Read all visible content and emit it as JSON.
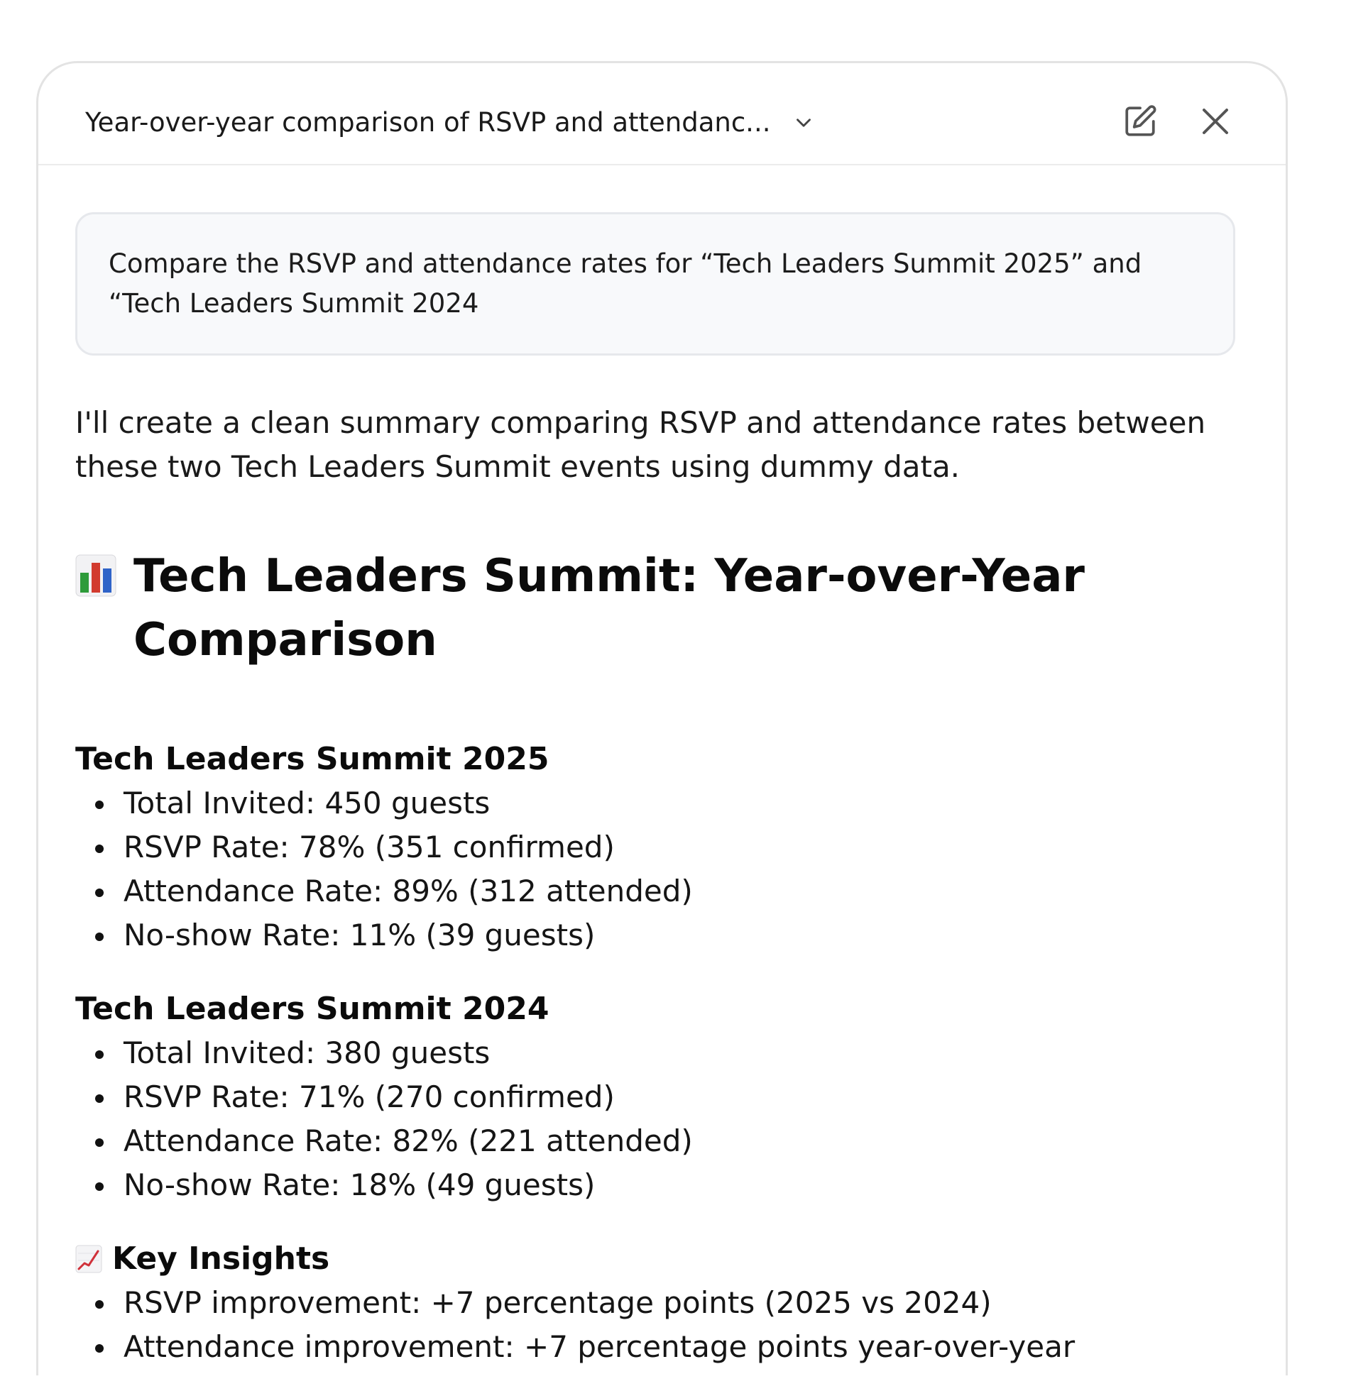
{
  "header": {
    "title": "Year-over-year comparison of RSVP and attendanc...",
    "icons": {
      "dropdown": "chevron-down-icon",
      "edit": "edit-icon",
      "close": "close-icon"
    }
  },
  "prompt": {
    "line1": "Compare the RSVP and attendance rates for “Tech Leaders Summit 2025” and",
    "line2": "“Tech Leaders Summit 2024"
  },
  "response": {
    "intro_line1": "I'll create a clean summary comparing RSVP and attendance rates between",
    "intro_line2": "these two Tech Leaders Summit events using dummy data.",
    "heading_line1": "Tech Leaders Summit: Year-over-Year",
    "heading_line2": "Comparison",
    "heading_icon": "bar-chart-emoji",
    "sections": [
      {
        "title": "Tech Leaders Summit 2025",
        "items": [
          "Total Invited: 450 guests",
          "RSVP Rate: 78% (351 confirmed)",
          "Attendance Rate: 89% (312 attended)",
          "No-show Rate: 11% (39 guests)"
        ]
      },
      {
        "title": "Tech Leaders Summit 2024",
        "items": [
          "Total Invited: 380 guests",
          "RSVP Rate: 71% (270 confirmed)",
          "Attendance Rate: 82% (221 attended)",
          "No-show Rate: 18% (49 guests)"
        ]
      },
      {
        "title": "Key Insights",
        "icon": "trend-up-emoji",
        "items": [
          "RSVP improvement: +7 percentage points (2025 vs 2024)",
          "Attendance improvement: +7 percentage points year-over-year"
        ]
      }
    ]
  }
}
